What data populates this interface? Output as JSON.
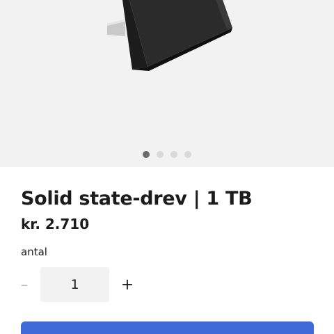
{
  "product": {
    "title": "Solid state-drev | 1 TB",
    "price": "kr. 2.710",
    "image_icon": "ssd-drive-image"
  },
  "gallery": {
    "dot_count": 4,
    "active_index": 0
  },
  "quantity": {
    "label": "antal",
    "value": "1",
    "decrement": "–",
    "increment": "+"
  },
  "colors": {
    "accent": "#3f6ad8",
    "gallery_bg": "#f2f2f2",
    "text": "#1b1b1b"
  }
}
